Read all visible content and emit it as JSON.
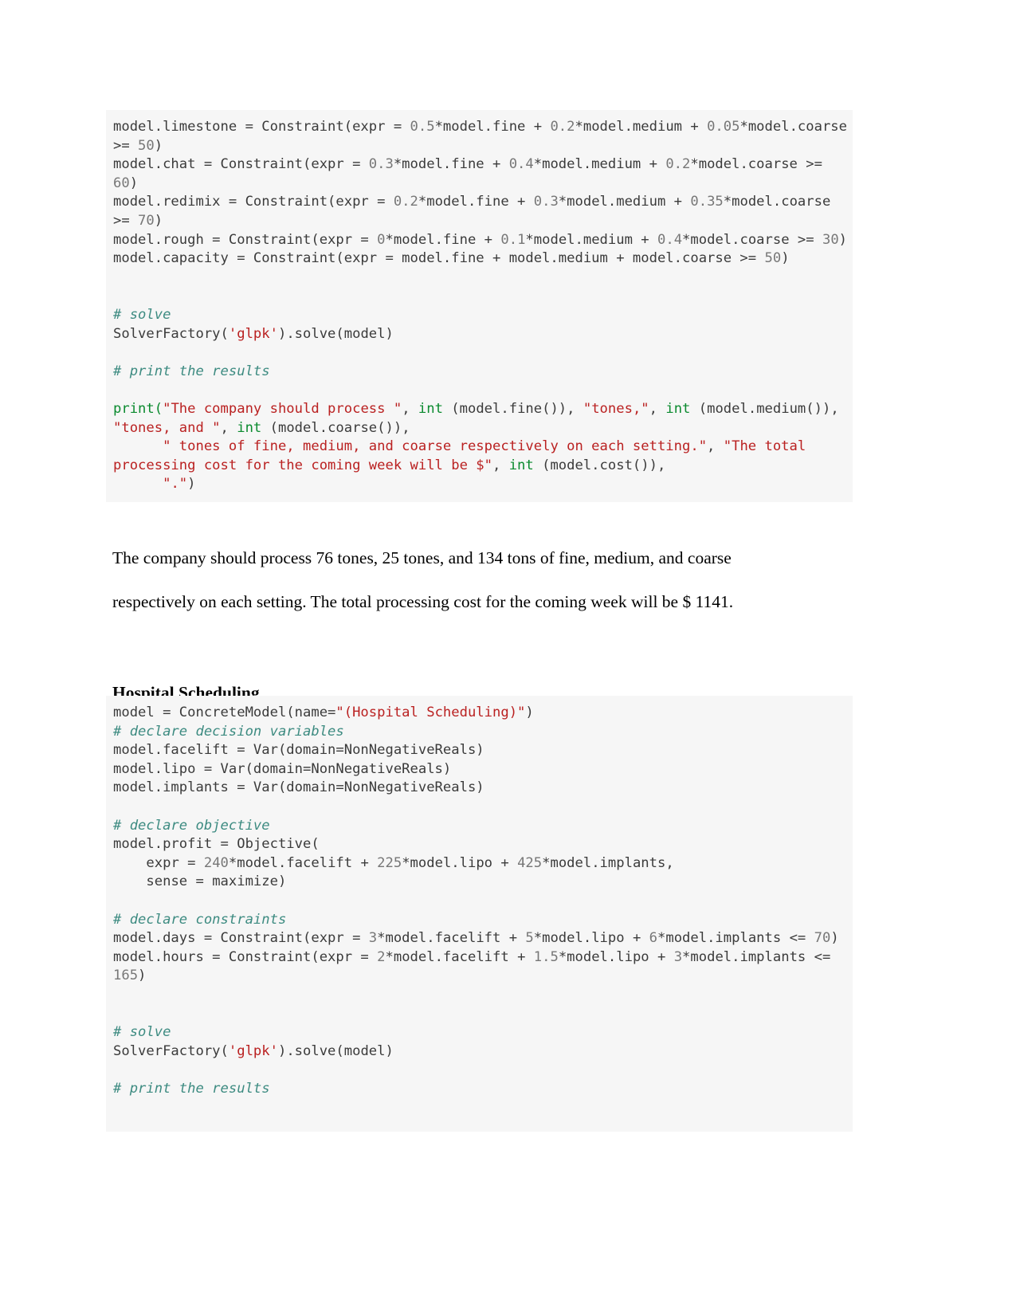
{
  "document": {
    "background_color": "#ffffff",
    "code_background_color": "#f6f6f6",
    "syntax_colors": {
      "comment": "#3d8b81",
      "string": "#ba2121",
      "keyword": "#0a8a2e",
      "number": "#777777",
      "default": "#3b3b3b"
    }
  },
  "code_block_1": {
    "name": "stone-processing-constraints-and-print",
    "lines": [
      [
        {
          "t": "model.limestone = Constraint(expr = ",
          "c": "d"
        },
        {
          "t": "0.5",
          "c": "n"
        },
        {
          "t": "*model.fine + ",
          "c": "d"
        },
        {
          "t": "0.2",
          "c": "n"
        },
        {
          "t": "*model.medium + ",
          "c": "d"
        },
        {
          "t": "0.05",
          "c": "n"
        },
        {
          "t": "*model.coarse >= ",
          "c": "d"
        },
        {
          "t": "50",
          "c": "n"
        },
        {
          "t": ")",
          "c": "d"
        }
      ],
      [
        {
          "t": "model.chat = Constraint(expr = ",
          "c": "d"
        },
        {
          "t": "0.3",
          "c": "n"
        },
        {
          "t": "*model.fine + ",
          "c": "d"
        },
        {
          "t": "0.4",
          "c": "n"
        },
        {
          "t": "*model.medium + ",
          "c": "d"
        },
        {
          "t": "0.2",
          "c": "n"
        },
        {
          "t": "*model.coarse >= ",
          "c": "d"
        },
        {
          "t": "60",
          "c": "n"
        },
        {
          "t": ")",
          "c": "d"
        }
      ],
      [
        {
          "t": "model.redimix = Constraint(expr = ",
          "c": "d"
        },
        {
          "t": "0.2",
          "c": "n"
        },
        {
          "t": "*model.fine + ",
          "c": "d"
        },
        {
          "t": "0.3",
          "c": "n"
        },
        {
          "t": "*model.medium + ",
          "c": "d"
        },
        {
          "t": "0.35",
          "c": "n"
        },
        {
          "t": "*model.coarse >= ",
          "c": "d"
        },
        {
          "t": "70",
          "c": "n"
        },
        {
          "t": ")",
          "c": "d"
        }
      ],
      [
        {
          "t": "model.rough = Constraint(expr = ",
          "c": "d"
        },
        {
          "t": "0",
          "c": "n"
        },
        {
          "t": "*model.fine + ",
          "c": "d"
        },
        {
          "t": "0.1",
          "c": "n"
        },
        {
          "t": "*model.medium + ",
          "c": "d"
        },
        {
          "t": "0.4",
          "c": "n"
        },
        {
          "t": "*model.coarse >= ",
          "c": "d"
        },
        {
          "t": "30",
          "c": "n"
        },
        {
          "t": ")",
          "c": "d"
        }
      ],
      [
        {
          "t": "model.capacity = Constraint(expr = model.fine + model.medium + model.coarse >= ",
          "c": "d"
        },
        {
          "t": "50",
          "c": "n"
        },
        {
          "t": ")",
          "c": "d"
        }
      ],
      [],
      [],
      [
        {
          "t": "# solve",
          "c": "c"
        }
      ],
      [
        {
          "t": "SolverFactory(",
          "c": "d"
        },
        {
          "t": "'glpk'",
          "c": "s"
        },
        {
          "t": ").solve(model)",
          "c": "d"
        }
      ],
      [],
      [
        {
          "t": "# print the results",
          "c": "c"
        }
      ],
      [],
      [
        {
          "t": "print(",
          "c": "k"
        },
        {
          "t": "\"The company should process \"",
          "c": "s"
        },
        {
          "t": ", ",
          "c": "d"
        },
        {
          "t": "int",
          "c": "k"
        },
        {
          "t": " (model.fine()), ",
          "c": "d"
        },
        {
          "t": "\"tones,\"",
          "c": "s"
        },
        {
          "t": ", ",
          "c": "d"
        },
        {
          "t": "int",
          "c": "k"
        },
        {
          "t": " (model.medium()), ",
          "c": "d"
        },
        {
          "t": "\"tones, and \"",
          "c": "s"
        },
        {
          "t": ", ",
          "c": "d"
        },
        {
          "t": "int",
          "c": "k"
        },
        {
          "t": " (model.coarse()),",
          "c": "d"
        }
      ],
      [
        {
          "t": "      ",
          "c": "d"
        },
        {
          "t": "\" tones of fine, medium, and coarse respectively on each setting.\"",
          "c": "s"
        },
        {
          "t": ", ",
          "c": "d"
        },
        {
          "t": "\"The total processing cost for the coming week will be $\"",
          "c": "s"
        },
        {
          "t": ", ",
          "c": "d"
        },
        {
          "t": "int",
          "c": "k"
        },
        {
          "t": " (model.cost()),",
          "c": "d"
        }
      ],
      [
        {
          "t": "      ",
          "c": "d"
        },
        {
          "t": "\".\"",
          "c": "s"
        },
        {
          "t": ")",
          "c": "d"
        }
      ]
    ]
  },
  "output_text": {
    "line_1": "The company should process 76 tones, 25 tones, and 134 tons of fine, medium, and coarse",
    "line_2": "respectively on each setting. The total processing cost for the coming week will be $ 1141."
  },
  "heading": {
    "hospital_scheduling": "Hospital Scheduling"
  },
  "code_block_2": {
    "name": "hospital-scheduling-model",
    "lines": [
      [
        {
          "t": "model = ConcreteModel(name=",
          "c": "d"
        },
        {
          "t": "\"(Hospital Scheduling)\"",
          "c": "s"
        },
        {
          "t": ")",
          "c": "d"
        }
      ],
      [
        {
          "t": "# declare decision variables",
          "c": "c"
        }
      ],
      [
        {
          "t": "model.facelift = Var(domain=NonNegativeReals)",
          "c": "d"
        }
      ],
      [
        {
          "t": "model.lipo = Var(domain=NonNegativeReals)",
          "c": "d"
        }
      ],
      [
        {
          "t": "model.implants = Var(domain=NonNegativeReals)",
          "c": "d"
        }
      ],
      [],
      [
        {
          "t": "# declare objective",
          "c": "c"
        }
      ],
      [
        {
          "t": "model.profit = Objective(",
          "c": "d"
        }
      ],
      [
        {
          "t": "    expr = ",
          "c": "d"
        },
        {
          "t": "240",
          "c": "n"
        },
        {
          "t": "*model.facelift + ",
          "c": "d"
        },
        {
          "t": "225",
          "c": "n"
        },
        {
          "t": "*model.lipo + ",
          "c": "d"
        },
        {
          "t": "425",
          "c": "n"
        },
        {
          "t": "*model.implants,",
          "c": "d"
        }
      ],
      [
        {
          "t": "    sense = maximize)",
          "c": "d"
        }
      ],
      [],
      [
        {
          "t": "# declare constraints",
          "c": "c"
        }
      ],
      [
        {
          "t": "model.days = Constraint(expr = ",
          "c": "d"
        },
        {
          "t": "3",
          "c": "n"
        },
        {
          "t": "*model.facelift + ",
          "c": "d"
        },
        {
          "t": "5",
          "c": "n"
        },
        {
          "t": "*model.lipo + ",
          "c": "d"
        },
        {
          "t": "6",
          "c": "n"
        },
        {
          "t": "*model.implants <= ",
          "c": "d"
        },
        {
          "t": "70",
          "c": "n"
        },
        {
          "t": ")",
          "c": "d"
        }
      ],
      [
        {
          "t": "model.hours = Constraint(expr = ",
          "c": "d"
        },
        {
          "t": "2",
          "c": "n"
        },
        {
          "t": "*model.facelift + ",
          "c": "d"
        },
        {
          "t": "1.5",
          "c": "n"
        },
        {
          "t": "*model.lipo + ",
          "c": "d"
        },
        {
          "t": "3",
          "c": "n"
        },
        {
          "t": "*model.implants <= ",
          "c": "d"
        },
        {
          "t": "165",
          "c": "n"
        },
        {
          "t": ")",
          "c": "d"
        }
      ],
      [],
      [],
      [
        {
          "t": "# solve",
          "c": "c"
        }
      ],
      [
        {
          "t": "SolverFactory(",
          "c": "d"
        },
        {
          "t": "'glpk'",
          "c": "s"
        },
        {
          "t": ").solve(model)",
          "c": "d"
        }
      ],
      [],
      [
        {
          "t": "# print the results",
          "c": "c"
        }
      ],
      []
    ]
  }
}
